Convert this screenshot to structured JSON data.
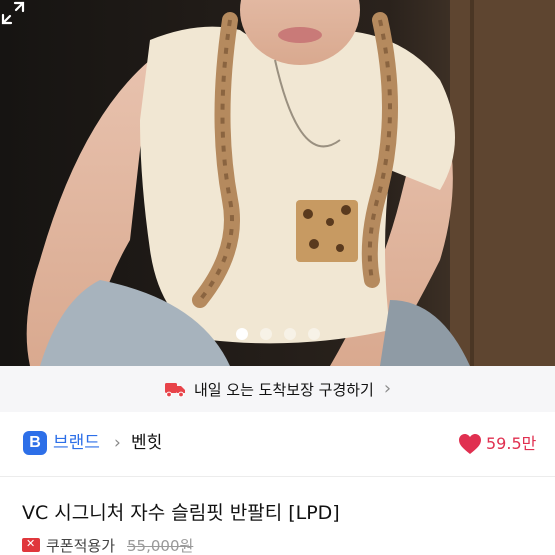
{
  "photo": {
    "alt": "",
    "carousel": {
      "count": 4,
      "active_index": 0
    },
    "expand_icon": "expand-icon"
  },
  "banner": {
    "icon": "truck-icon",
    "text": "내일 오는 도착보장 구경하기",
    "chevron": "›"
  },
  "brand": {
    "badge": "B",
    "link_label": "브랜드",
    "separator": "›",
    "name": "벤힛"
  },
  "likes": {
    "icon": "heart-icon",
    "count": "59.5만"
  },
  "product": {
    "title": "VC 시그니처 자수 슬림핏 반팔티 [LPD]",
    "coupon_label": "쿠폰적용가",
    "original_price": "55,000원"
  },
  "colors": {
    "brand_blue": "#2d6fe8",
    "like_red": "#e03050",
    "coupon_red": "#e0373c"
  }
}
